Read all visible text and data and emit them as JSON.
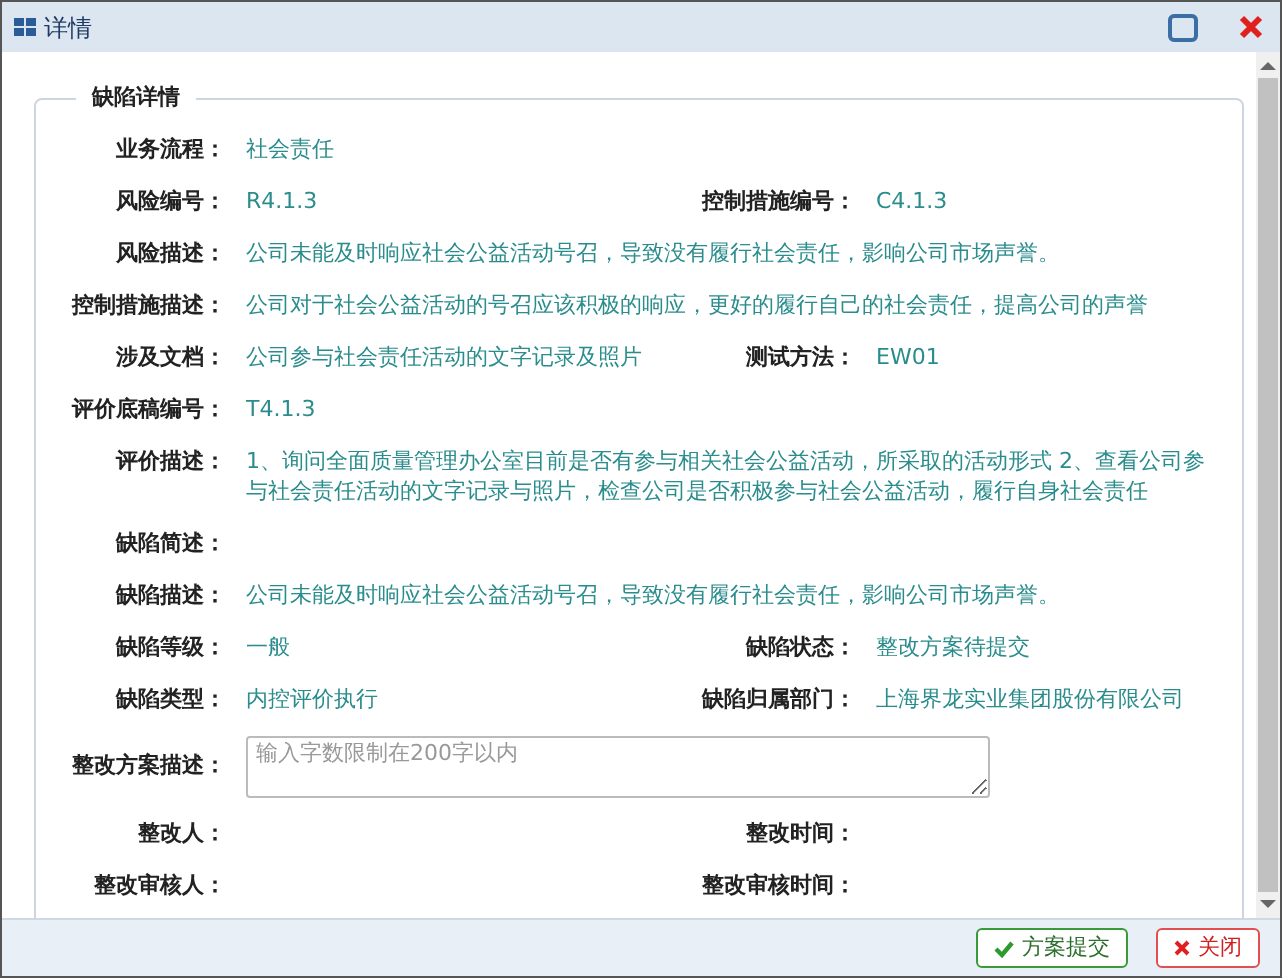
{
  "window": {
    "title": "详情"
  },
  "section": {
    "legend": "缺陷详情"
  },
  "rows": [
    {
      "kind": "pair",
      "fields": [
        {
          "label": "业务流程：",
          "value": "社会责任"
        }
      ]
    },
    {
      "kind": "pair",
      "fields": [
        {
          "label": "风险编号：",
          "value": "R4.1.3"
        },
        {
          "label": "控制措施编号：",
          "value": "C4.1.3"
        }
      ]
    },
    {
      "kind": "full",
      "fields": [
        {
          "label": "风险描述：",
          "value": "公司未能及时响应社会公益活动号召，导致没有履行社会责任，影响公司市场声誉。"
        }
      ]
    },
    {
      "kind": "full",
      "fields": [
        {
          "label": "控制措施描述：",
          "value": "公司对于社会公益活动的号召应该积极的响应，更好的履行自己的社会责任，提高公司的声誉"
        }
      ]
    },
    {
      "kind": "pair",
      "fields": [
        {
          "label": "涉及文档：",
          "value": "公司参与社会责任活动的文字记录及照片"
        },
        {
          "label": "测试方法：",
          "value": "EW01"
        }
      ]
    },
    {
      "kind": "full",
      "fields": [
        {
          "label": "评价底稿编号：",
          "value": "T4.1.3"
        }
      ]
    },
    {
      "kind": "full",
      "fields": [
        {
          "label": "评价描述：",
          "value": "1、询问全面质量管理办公室目前是否有参与相关社会公益活动，所采取的活动形式 2、查看公司参与社会责任活动的文字记录与照片，检查公司是否积极参与社会公益活动，履行自身社会责任"
        }
      ]
    },
    {
      "kind": "full",
      "fields": [
        {
          "label": "缺陷简述："
        }
      ]
    },
    {
      "kind": "full",
      "fields": [
        {
          "label": "缺陷描述：",
          "value": "公司未能及时响应社会公益活动号召，导致没有履行社会责任，影响公司市场声誉。"
        }
      ]
    },
    {
      "kind": "pair",
      "fields": [
        {
          "label": "缺陷等级：",
          "value": "一般"
        },
        {
          "label": "缺陷状态：",
          "value": "整改方案待提交"
        }
      ]
    },
    {
      "kind": "pair",
      "fields": [
        {
          "label": "缺陷类型：",
          "value": "内控评价执行"
        },
        {
          "label": "缺陷归属部门：",
          "value": "上海界龙实业集团股份有限公司"
        }
      ]
    },
    {
      "kind": "textarea",
      "fields": [
        {
          "label": "整改方案描述：",
          "placeholder": "输入字数限制在200字以内"
        }
      ]
    },
    {
      "kind": "pair",
      "fields": [
        {
          "label": "整改人："
        },
        {
          "label": "整改时间："
        }
      ]
    },
    {
      "kind": "pair",
      "fields": [
        {
          "label": "整改审核人："
        },
        {
          "label": "整改审核时间："
        }
      ]
    }
  ],
  "buttons": [
    {
      "label": "方案提交",
      "kind": "submit"
    },
    {
      "label": "关闭",
      "kind": "close"
    }
  ]
}
